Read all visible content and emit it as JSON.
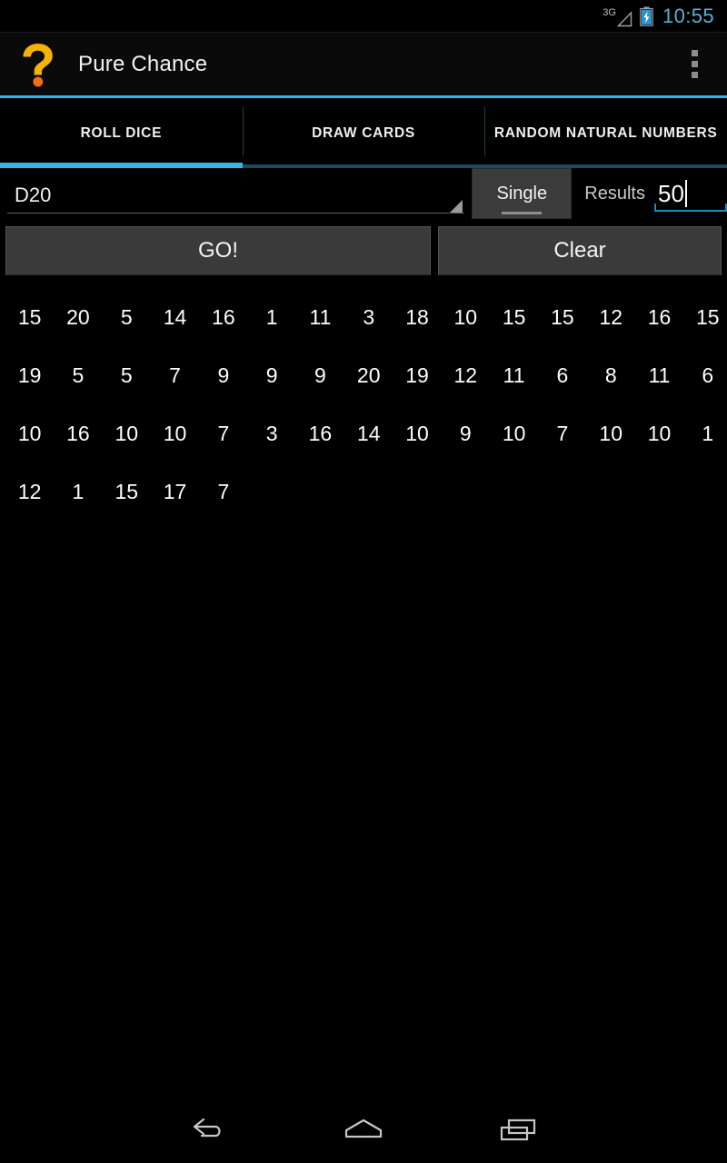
{
  "statusbar": {
    "network_label": "3G",
    "time": "10:55",
    "time_color": "#4fb3d9",
    "signal_icon": "signal-triangle-icon",
    "battery_icon": "battery-charging-icon"
  },
  "actionbar": {
    "app_icon": "question-mark-icon",
    "title": "Pure Chance",
    "overflow_icon": "overflow-menu-icon",
    "accent_color": "#33b5e5"
  },
  "tabs": [
    {
      "label": "ROLL DICE",
      "active": true
    },
    {
      "label": "DRAW CARDS",
      "active": false
    },
    {
      "label": "RANDOM NATURAL NUMBERS",
      "active": false
    }
  ],
  "controls": {
    "dice_spinner": {
      "value": "D20",
      "dropdown_icon": "dropdown-triangle-icon"
    },
    "mode_spinner": {
      "value": "Single"
    },
    "results_label": "Results",
    "results_count": {
      "value": "50",
      "underline_color": "#1d8ab3"
    }
  },
  "buttons": {
    "go_label": "GO!",
    "clear_label": "Clear"
  },
  "results": {
    "rows": [
      [
        "15",
        "20",
        "5",
        "14",
        "16",
        "1",
        "11",
        "3",
        "18",
        "10",
        "15",
        "15",
        "12",
        "16",
        "15"
      ],
      [
        "19",
        "5",
        "5",
        "7",
        "9",
        "9",
        "9",
        "20",
        "19",
        "12",
        "11",
        "6",
        "8",
        "11",
        "6"
      ],
      [
        "10",
        "16",
        "10",
        "10",
        "7",
        "3",
        "16",
        "14",
        "10",
        "9",
        "10",
        "7",
        "10",
        "10",
        "1"
      ],
      [
        "12",
        "1",
        "15",
        "17",
        "7"
      ]
    ]
  },
  "navbar": {
    "back_icon": "back-arrow-icon",
    "home_icon": "home-icon",
    "recents_icon": "recent-apps-icon"
  }
}
